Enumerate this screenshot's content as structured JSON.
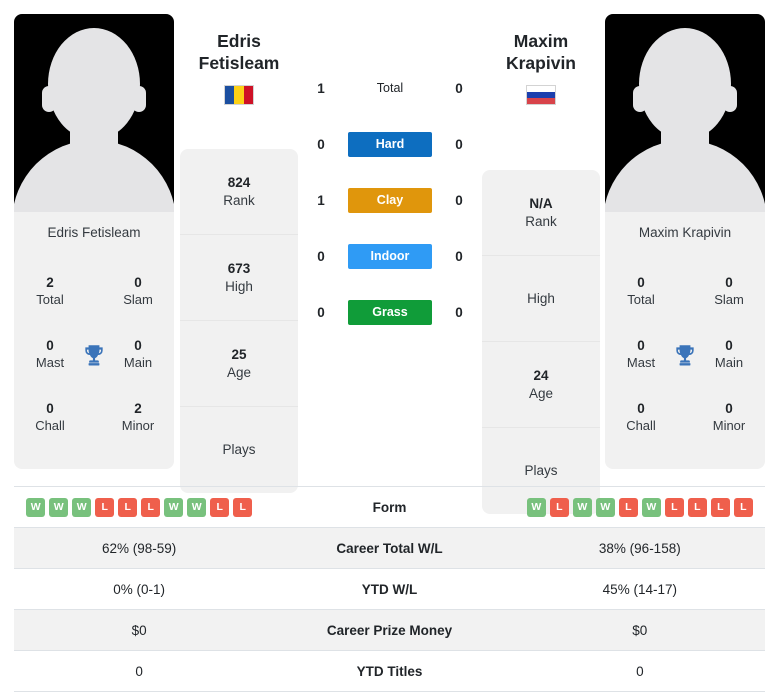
{
  "players": {
    "left": {
      "first_name": "Edris",
      "last_name": "Fetisleam",
      "full_name": "Edris Fetisleam",
      "country": "Romania",
      "flag_type": "vertical",
      "flag_colors": [
        "#1b4fa0",
        "#fcd116",
        "#ce1126"
      ],
      "rank": "824",
      "rank_label": "Rank",
      "high": "673",
      "high_label": "High",
      "age": "25",
      "age_label": "Age",
      "plays": "",
      "plays_label": "Plays",
      "titles": {
        "total": "2",
        "total_label": "Total",
        "slam": "0",
        "slam_label": "Slam",
        "mast": "0",
        "mast_label": "Mast",
        "main": "0",
        "main_label": "Main",
        "chall": "0",
        "chall_label": "Chall",
        "minor": "2",
        "minor_label": "Minor"
      }
    },
    "right": {
      "first_name": "Maxim",
      "last_name": "Krapivin",
      "full_name": "Maxim Krapivin",
      "country": "Russia",
      "flag_type": "horizontal",
      "flag_colors": [
        "#ffffff",
        "#1b3fae",
        "#d8434a"
      ],
      "rank": "N/A",
      "rank_label": "Rank",
      "high": "",
      "high_label": "High",
      "age": "24",
      "age_label": "Age",
      "plays": "",
      "plays_label": "Plays",
      "titles": {
        "total": "0",
        "total_label": "Total",
        "slam": "0",
        "slam_label": "Slam",
        "mast": "0",
        "mast_label": "Mast",
        "main": "0",
        "main_label": "Main",
        "chall": "0",
        "chall_label": "Chall",
        "minor": "0",
        "minor_label": "Minor"
      }
    }
  },
  "surfaces": [
    {
      "label": "Total",
      "left": "1",
      "right": "0",
      "color": "transparent",
      "plain": true
    },
    {
      "label": "Hard",
      "left": "0",
      "right": "0",
      "color": "#0d6ec0"
    },
    {
      "label": "Clay",
      "left": "1",
      "right": "0",
      "color": "#e0960c"
    },
    {
      "label": "Indoor",
      "left": "0",
      "right": "0",
      "color": "#2f9bf5"
    },
    {
      "label": "Grass",
      "left": "0",
      "right": "0",
      "color": "#109c39"
    }
  ],
  "stats_table": {
    "form": {
      "label": "Form",
      "left": [
        "W",
        "W",
        "W",
        "L",
        "L",
        "L",
        "W",
        "W",
        "L",
        "L"
      ],
      "right": [
        "W",
        "L",
        "W",
        "W",
        "L",
        "W",
        "L",
        "L",
        "L",
        "L"
      ]
    },
    "rows": [
      {
        "label": "Career Total W/L",
        "left": "62% (98-59)",
        "right": "38% (96-158)"
      },
      {
        "label": "YTD W/L",
        "left": "0% (0-1)",
        "right": "45% (14-17)"
      },
      {
        "label": "Career Prize Money",
        "left": "$0",
        "right": "$0"
      },
      {
        "label": "YTD Titles",
        "left": "0",
        "right": "0"
      }
    ]
  },
  "icons": {
    "trophy": "trophy-icon"
  },
  "colors": {
    "win": "#78c17d",
    "loss": "#ef5f4c",
    "card_bg": "#f1f1f1",
    "row_alt": "#f2f2f2"
  }
}
